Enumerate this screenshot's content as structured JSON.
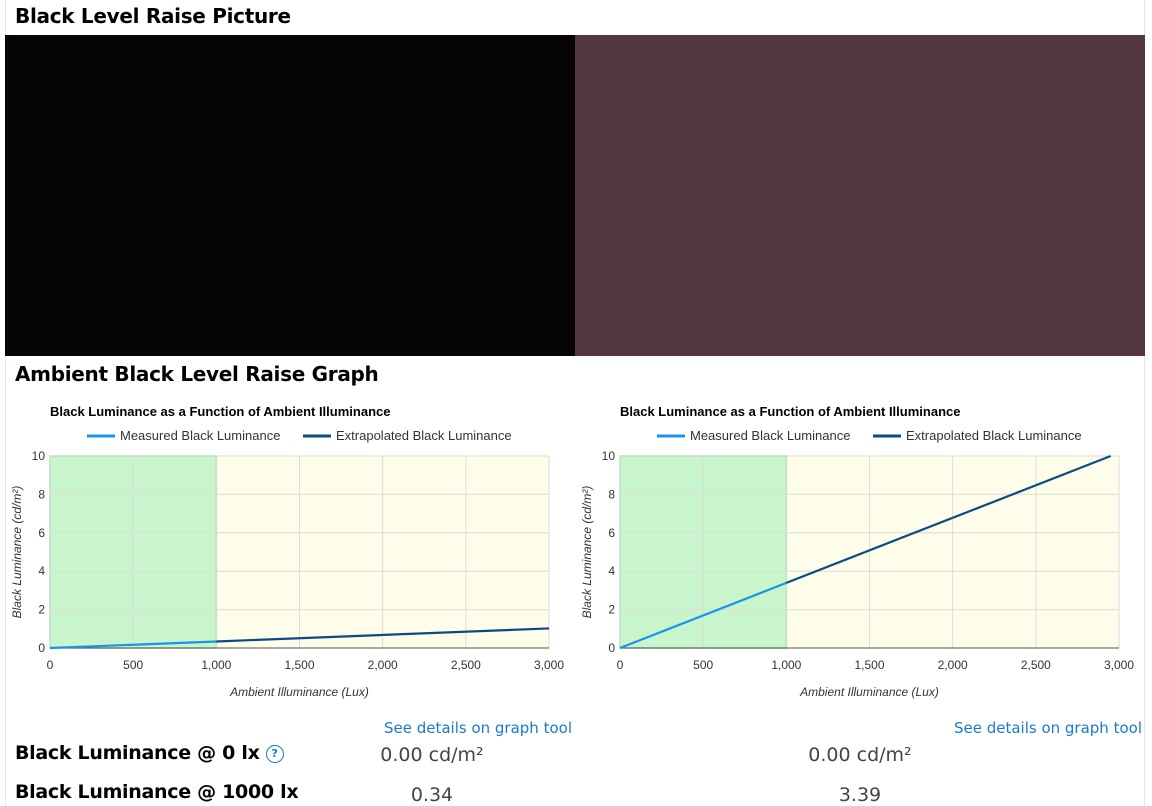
{
  "page": {
    "picture_title": "Black Level Raise Picture",
    "graph_title": "Ambient Black Level Raise Graph"
  },
  "pictures": {
    "left_color": "#070408",
    "right_color": "#553740"
  },
  "chart_data": [
    {
      "type": "line",
      "title": "Black Luminance as a Function of Ambient Illuminance",
      "xlabel": "Ambient Illuminance (Lux)",
      "ylabel": "Black Luminance (cd/m²)",
      "xlim": [
        0,
        3000
      ],
      "ylim": [
        0,
        10
      ],
      "x_ticks": [
        "0",
        "500",
        "1,000",
        "1,500",
        "2,000",
        "2,500",
        "3,000"
      ],
      "y_ticks": [
        "0",
        "2",
        "4",
        "6",
        "8",
        "10"
      ],
      "grid": true,
      "legend": "top",
      "bands": [
        {
          "x_from": 0,
          "x_to": 1000,
          "color": "#c8f5cc"
        },
        {
          "x_from": 1000,
          "x_to": 3000,
          "color": "#fdfdea"
        }
      ],
      "series": [
        {
          "name": "Measured Black Luminance",
          "color": "#1895e8",
          "x": [
            0,
            1000
          ],
          "y": [
            0.0,
            0.34
          ]
        },
        {
          "name": "Extrapolated Black Luminance",
          "color": "#0a4b84",
          "x": [
            1000,
            3000
          ],
          "y": [
            0.34,
            1.02
          ]
        }
      ]
    },
    {
      "type": "line",
      "title": "Black Luminance as a Function of Ambient Illuminance",
      "xlabel": "Ambient Illuminance (Lux)",
      "ylabel": "Black Luminance (cd/m²)",
      "xlim": [
        0,
        3000
      ],
      "ylim": [
        0,
        10
      ],
      "x_ticks": [
        "0",
        "500",
        "1,000",
        "1,500",
        "2,000",
        "2,500",
        "3,000"
      ],
      "y_ticks": [
        "0",
        "2",
        "4",
        "6",
        "8",
        "10"
      ],
      "grid": true,
      "legend": "top",
      "bands": [
        {
          "x_from": 0,
          "x_to": 1000,
          "color": "#c8f5cc"
        },
        {
          "x_from": 1000,
          "x_to": 3000,
          "color": "#fdfdea"
        }
      ],
      "series": [
        {
          "name": "Measured Black Luminance",
          "color": "#1895e8",
          "x": [
            0,
            1000
          ],
          "y": [
            0.0,
            3.39
          ]
        },
        {
          "name": "Extrapolated Black Luminance",
          "color": "#0a4b84",
          "x": [
            1000,
            2950
          ],
          "y": [
            3.39,
            10.0
          ]
        }
      ]
    }
  ],
  "links": [
    "See details on graph tool",
    "See details on graph tool"
  ],
  "rows": [
    {
      "label": "Black Luminance @ 0 lx",
      "help_icon": "question-circle-icon",
      "values": [
        "0.00 cd/m²",
        "0.00 cd/m²"
      ]
    },
    {
      "label": "Black Luminance @ 1000 lx",
      "values": [
        "0.34",
        "3.39"
      ]
    }
  ]
}
